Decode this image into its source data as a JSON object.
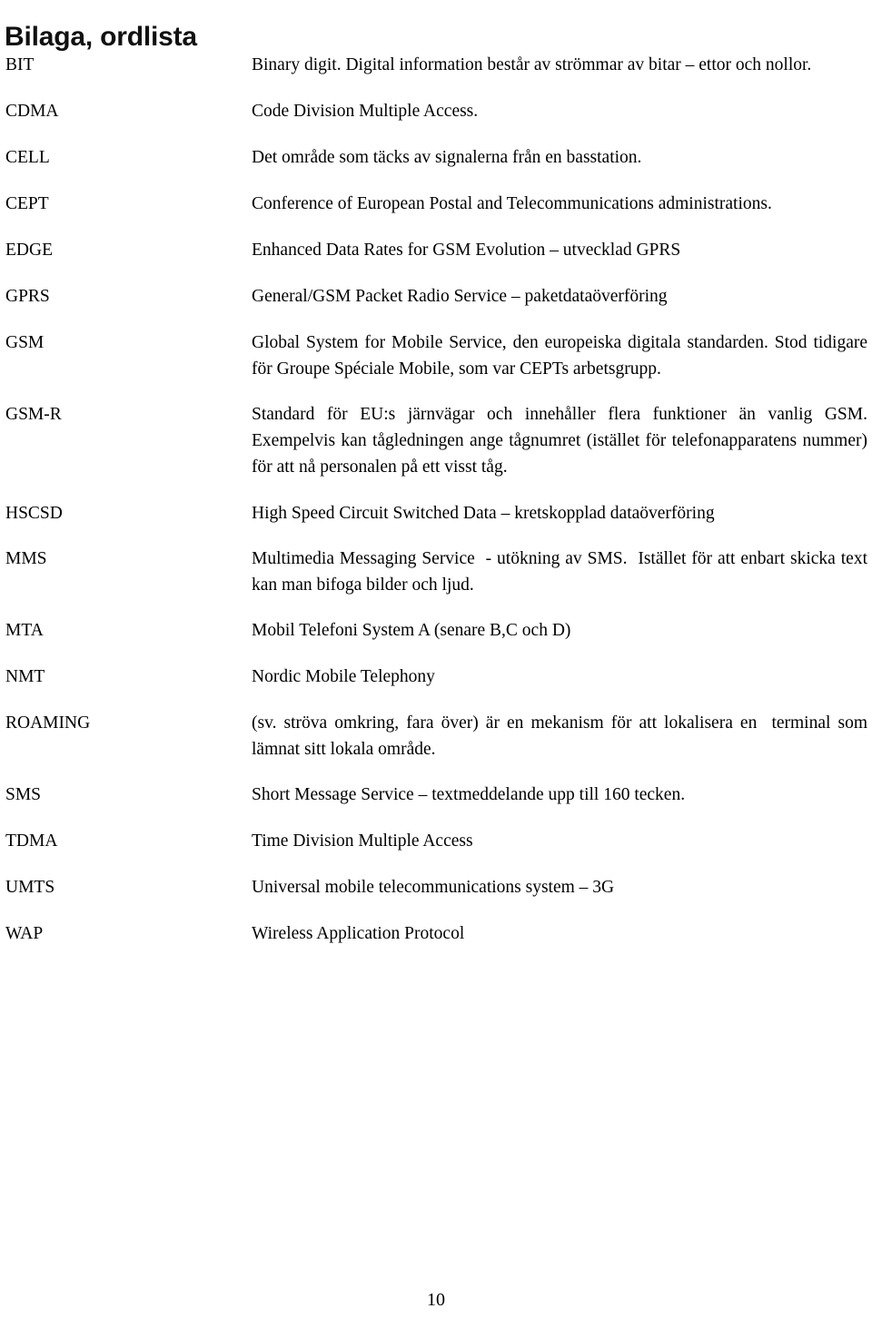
{
  "document": {
    "title": "Bilaga, ordlista",
    "page_number": "10"
  },
  "glossary": {
    "entries": [
      {
        "term": "BIT",
        "definition": "Binary digit. Digital information består av strömmar av bitar – ettor och nollor.",
        "justified": false,
        "gap_before": 0
      },
      {
        "term": "CDMA",
        "definition": "Code Division Multiple Access.",
        "justified": false,
        "gap_before": 22
      },
      {
        "term": "CELL",
        "definition": "Det område som täcks av signalerna från en basstation.",
        "justified": false,
        "gap_before": 22
      },
      {
        "term": "CEPT",
        "definition": "Conference of European Postal and Telecommunications administrations.",
        "justified": false,
        "gap_before": 22
      },
      {
        "term": "EDGE",
        "definition": "Enhanced Data Rates for GSM Evolution – utvecklad GPRS",
        "justified": false,
        "gap_before": 22
      },
      {
        "term": "GPRS",
        "definition": "General/GSM Packet Radio Service – paketdataöverföring",
        "justified": false,
        "gap_before": 22
      },
      {
        "term": "GSM",
        "definition": "Global System for Mobile Service, den europeiska digitala standarden. Stod tidigare för Groupe Spéciale Mobile, som var CEPTs arbetsgrupp.",
        "justified": true,
        "gap_before": 22
      },
      {
        "term": "GSM-R",
        "definition": "Standard för EU:s järnvägar och innehåller flera funktioner än vanlig GSM. Exempelvis kan tågledningen ange tågnumret (istället för telefonapparatens nummer) för att nå personalen på ett visst tåg.",
        "justified": true,
        "gap_before": 21
      },
      {
        "term": "HSCSD",
        "definition": "High Speed Circuit Switched Data – kretskopplad dataöverföring",
        "justified": false,
        "gap_before": 22
      },
      {
        "term": "MMS",
        "definition": "Multimedia Messaging Service  - utökning av SMS.  Istället för att enbart skicka text kan man bifoga bilder och ljud.",
        "justified": true,
        "gap_before": 21
      },
      {
        "term": "MTA",
        "definition": "Mobil Telefoni System A (senare B,C och D)",
        "justified": false,
        "gap_before": 21
      },
      {
        "term": "NMT",
        "definition": "Nordic Mobile Telephony",
        "justified": false,
        "gap_before": 22
      },
      {
        "term": "ROAMING",
        "definition": "(sv. ströva omkring, fara över) är en mekanism för att lokalisera en  terminal som lämnat sitt lokala område.",
        "justified": true,
        "gap_before": 22
      },
      {
        "term": "SMS",
        "definition": "Short Message Service – textmeddelande upp till 160 tecken.",
        "justified": false,
        "gap_before": 21
      },
      {
        "term": "TDMA",
        "definition": "Time Division Multiple Access",
        "justified": false,
        "gap_before": 22
      },
      {
        "term": "UMTS",
        "definition": "Universal mobile telecommunications system – 3G",
        "justified": false,
        "gap_before": 22
      },
      {
        "term": "WAP",
        "definition": "Wireless Application Protocol",
        "justified": false,
        "gap_before": 22
      }
    ]
  }
}
